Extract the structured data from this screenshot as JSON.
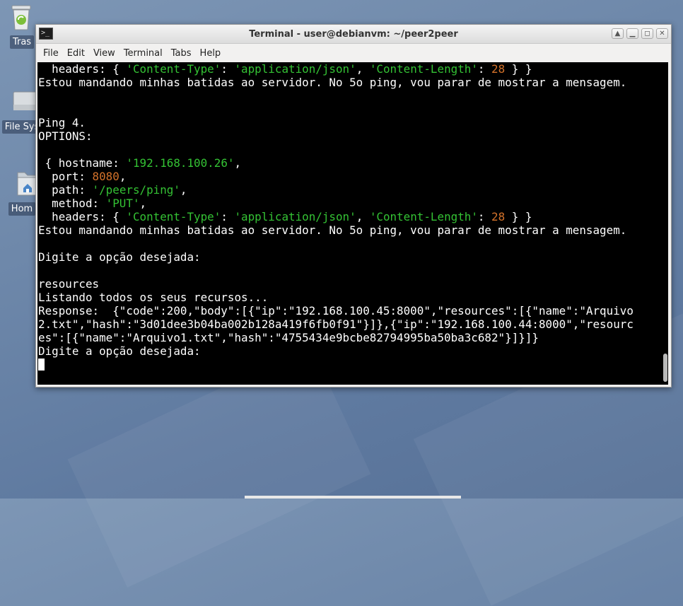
{
  "desktop": {
    "icons": [
      {
        "label": "Tras"
      },
      {
        "label": "File Sys"
      },
      {
        "label": "Hom"
      }
    ]
  },
  "window": {
    "title": "Terminal - user@debianvm: ~/peer2peer",
    "buttons": [
      "▲",
      "▁",
      "◻",
      "✕"
    ]
  },
  "menu": {
    "items": [
      "File",
      "Edit",
      "View",
      "Terminal",
      "Tabs",
      "Help"
    ]
  },
  "terminal": {
    "lines": [
      [
        [
          "  headers: { ",
          "w"
        ],
        [
          "'Content-Type'",
          "g"
        ],
        [
          ": ",
          "w"
        ],
        [
          "'application/json'",
          "g"
        ],
        [
          ", ",
          "w"
        ],
        [
          "'Content-Length'",
          "g"
        ],
        [
          ": ",
          "w"
        ],
        [
          "28",
          "o"
        ],
        [
          " } }",
          "w"
        ]
      ],
      [
        [
          "Estou mandando minhas batidas ao servidor. No 5o ping, vou parar de mostrar a mensagem.",
          "w"
        ]
      ],
      [],
      [],
      [
        [
          "Ping 4.",
          "w"
        ]
      ],
      [
        [
          "OPTIONS:",
          "w"
        ]
      ],
      [],
      [
        [
          " { hostname: ",
          "w"
        ],
        [
          "'192.168.100.26'",
          "g"
        ],
        [
          ",",
          "w"
        ]
      ],
      [
        [
          "  port: ",
          "w"
        ],
        [
          "8080",
          "o"
        ],
        [
          ",",
          "w"
        ]
      ],
      [
        [
          "  path: ",
          "w"
        ],
        [
          "'/peers/ping'",
          "g"
        ],
        [
          ",",
          "w"
        ]
      ],
      [
        [
          "  method: ",
          "w"
        ],
        [
          "'PUT'",
          "g"
        ],
        [
          ",",
          "w"
        ]
      ],
      [
        [
          "  headers: { ",
          "w"
        ],
        [
          "'Content-Type'",
          "g"
        ],
        [
          ": ",
          "w"
        ],
        [
          "'application/json'",
          "g"
        ],
        [
          ", ",
          "w"
        ],
        [
          "'Content-Length'",
          "g"
        ],
        [
          ": ",
          "w"
        ],
        [
          "28",
          "o"
        ],
        [
          " } }",
          "w"
        ]
      ],
      [
        [
          "Estou mandando minhas batidas ao servidor. No 5o ping, vou parar de mostrar a mensagem.",
          "w"
        ]
      ],
      [],
      [
        [
          "Digite a opção desejada:",
          "w"
        ]
      ],
      [],
      [
        [
          "resources",
          "w"
        ]
      ],
      [
        [
          "Listando todos os seus recursos...",
          "w"
        ]
      ],
      [
        [
          "Response:  {\"code\":200,\"body\":[{\"ip\":\"192.168.100.45:8000\",\"resources\":[{\"name\":\"Arquivo",
          "w"
        ]
      ],
      [
        [
          "2.txt\",\"hash\":\"3d01dee3b04ba002b128a419f6fb0f91\"}]},{\"ip\":\"192.168.100.44:8000\",\"resourc",
          "w"
        ]
      ],
      [
        [
          "es\":[{\"name\":\"Arquivo1.txt\",\"hash\":\"4755434e9bcbe82794995ba50ba3c682\"}]}]}",
          "w"
        ]
      ],
      [
        [
          "Digite a opção desejada:",
          "w"
        ]
      ],
      []
    ]
  }
}
